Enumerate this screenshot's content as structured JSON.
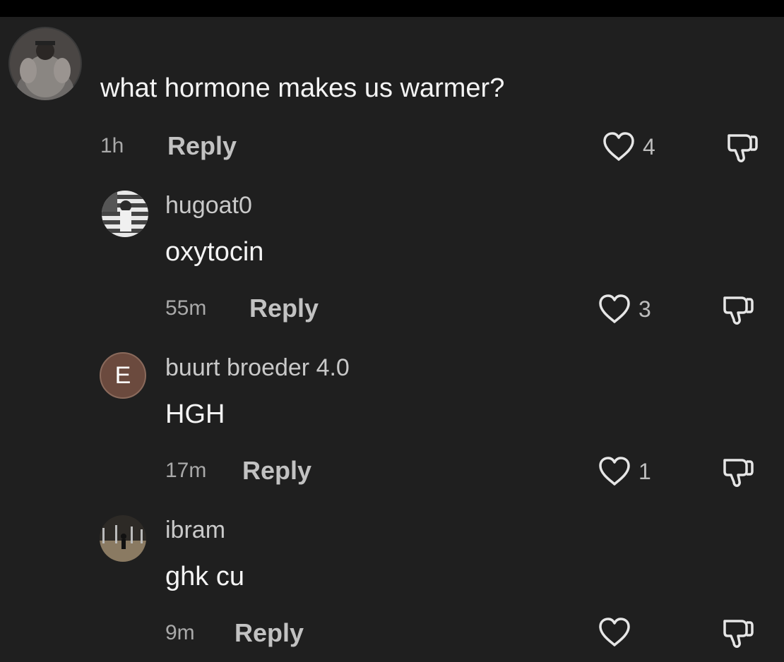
{
  "main_comment": {
    "text": "what hormone makes us warmer?",
    "time": "1h",
    "reply_label": "Reply",
    "like_count": "4",
    "icons": {
      "like": "heart-icon",
      "dislike": "thumbs-down-icon"
    }
  },
  "replies": [
    {
      "username": "hugoat0",
      "text": "oxytocin",
      "time": "55m",
      "reply_label": "Reply",
      "like_count": "3"
    },
    {
      "username": "buurt broeder 4.0",
      "avatar_letter": "E",
      "avatar_color": "#6b4a3e",
      "text": "HGH",
      "time": "17m",
      "reply_label": "Reply",
      "like_count": "1"
    },
    {
      "username": "ibram",
      "text": "ghk cu",
      "time": "9m",
      "reply_label": "Reply",
      "like_count": ""
    }
  ]
}
